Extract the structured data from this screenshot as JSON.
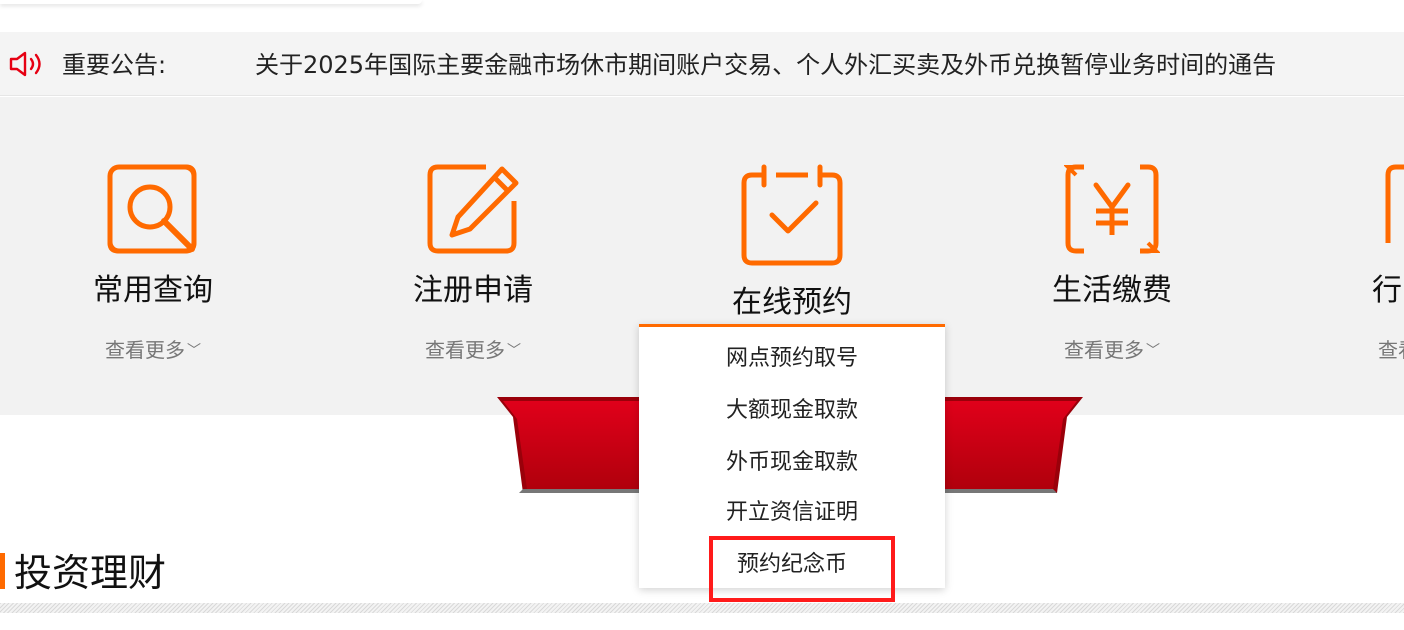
{
  "notice": {
    "icon": "speaker-icon",
    "label": "重要公告:",
    "text": "关于2025年国际主要金融市场休市期间账户交易、个人外汇买卖及外币兑换暂停业务时间的通告"
  },
  "services": [
    {
      "icon": "search-icon",
      "title": "常用查询",
      "more": "查看更多"
    },
    {
      "icon": "edit-icon",
      "title": "注册申请",
      "more": "查看更多"
    },
    {
      "icon": "calendar-check-icon",
      "title": "在线预约",
      "more": ""
    },
    {
      "icon": "yen-icon",
      "title": "生活缴费",
      "more": "查看更多"
    },
    {
      "icon": "partial-icon",
      "title": "行",
      "more": "查看"
    }
  ],
  "dropdown": {
    "items": [
      "网点预约取号",
      "大额现金取款",
      "外币现金取款",
      "开立资信证明",
      "预约纪念币"
    ]
  },
  "section": {
    "title": "投资理财"
  },
  "colors": {
    "accent": "#ff6a00",
    "ribbon": "#c8000f",
    "highlight": "#ff1a1a"
  }
}
